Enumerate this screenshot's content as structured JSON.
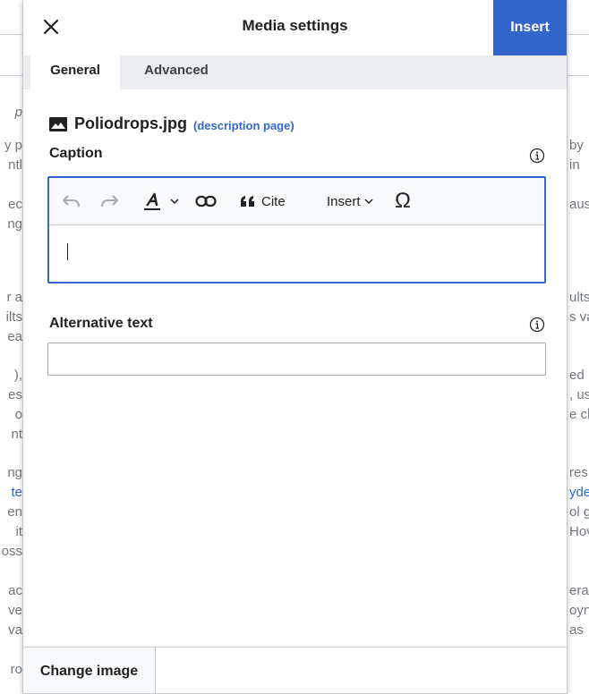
{
  "background": {
    "left_fragments": [
      "p",
      "y p",
      "ntl",
      "ec",
      "ng",
      "r a",
      "ilts",
      "ea",
      "),",
      "es",
      "o",
      "nt",
      "ng",
      "te",
      "en",
      "it",
      "oss",
      "ac",
      "ve",
      "va",
      "ro"
    ],
    "right_fragments": [
      "by",
      "in",
      "aus",
      "ults",
      "s va",
      "ed",
      ", us",
      "e ch",
      "res",
      "yde",
      "ol g",
      "Hov",
      "era",
      "oyn",
      "as"
    ]
  },
  "dialog": {
    "title": "Media settings",
    "close_icon": "close-icon",
    "insert_label": "Insert",
    "accent_color": "#3366cc"
  },
  "tabs": [
    {
      "label": "General",
      "active": true
    },
    {
      "label": "Advanced",
      "active": false
    }
  ],
  "image": {
    "icon": "image-icon",
    "filename": "Poliodrops.jpg",
    "description_link": "(description page)"
  },
  "caption": {
    "label": "Caption",
    "info_icon": "info-icon",
    "value": "",
    "toolbar": {
      "undo_icon": "undo-icon",
      "redo_icon": "redo-icon",
      "text_style_icon": "text-style-icon",
      "link_icon": "link-icon",
      "cite_icon": "quote-icon",
      "cite_label": "Cite",
      "insert_label": "Insert",
      "special_char_icon": "omega-icon"
    }
  },
  "alt_text": {
    "label": "Alternative text",
    "info_icon": "info-icon",
    "value": ""
  },
  "footer": {
    "change_image_label": "Change image"
  }
}
